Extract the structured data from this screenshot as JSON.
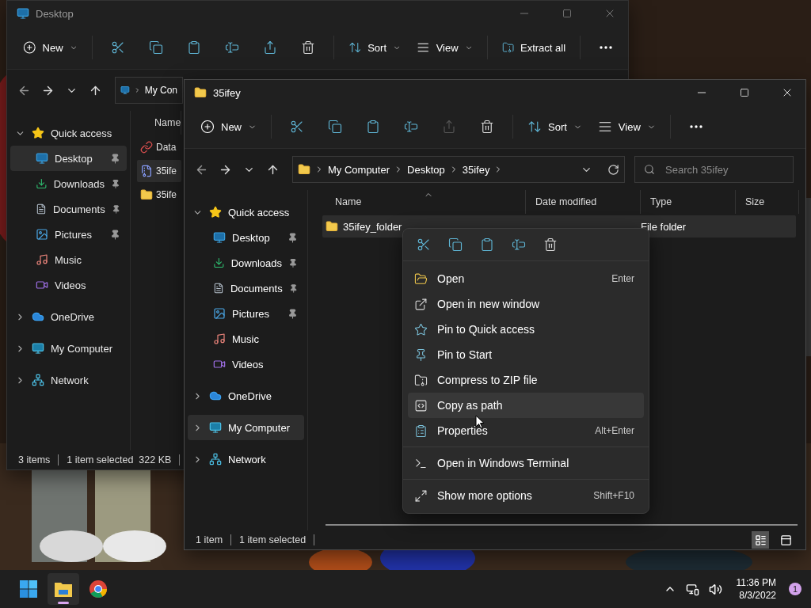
{
  "windows": [
    {
      "title": "Desktop",
      "active": false,
      "toolbar": [
        {
          "kind": "new",
          "label": "New",
          "disabled": false
        },
        {
          "kind": "cut",
          "disabled": false
        },
        {
          "kind": "copy",
          "disabled": false
        },
        {
          "kind": "paste",
          "disabled": false
        },
        {
          "kind": "rename",
          "disabled": false
        },
        {
          "kind": "share",
          "disabled": false
        },
        {
          "kind": "delete",
          "disabled": false
        },
        {
          "kind": "sort",
          "label": "Sort",
          "disabled": false
        },
        {
          "kind": "view",
          "label": "View",
          "disabled": false
        },
        {
          "kind": "extract",
          "label": "Extract all",
          "disabled": false
        },
        {
          "kind": "more",
          "disabled": false
        }
      ],
      "address": {
        "segments": [
          "My Con"
        ]
      },
      "sidebar": [
        {
          "label": "Quick access",
          "kind": "star",
          "expanded": true,
          "selected": false,
          "children": [
            {
              "label": "Desktop",
              "kind": "desktop",
              "pinned": true,
              "selected": true
            },
            {
              "label": "Downloads",
              "kind": "downloads",
              "pinned": true,
              "selected": false
            },
            {
              "label": "Documents",
              "kind": "documents",
              "pinned": true,
              "selected": false
            },
            {
              "label": "Pictures",
              "kind": "pictures",
              "pinned": true,
              "selected": false
            },
            {
              "label": "Music",
              "kind": "music",
              "pinned": false,
              "selected": false
            },
            {
              "label": "Videos",
              "kind": "videos",
              "pinned": false,
              "selected": false
            }
          ]
        },
        {
          "label": "OneDrive",
          "kind": "cloud",
          "expanded": false,
          "selected": false
        },
        {
          "label": "My Computer",
          "kind": "computer",
          "expanded": false,
          "selected": false
        },
        {
          "label": "Network",
          "kind": "network",
          "expanded": false,
          "selected": false
        }
      ],
      "columns": [
        "Name"
      ],
      "rows": [
        {
          "name": "Data",
          "kind": "shortcut",
          "selected": false
        },
        {
          "name": "35ife",
          "kind": "archive",
          "selected": true
        },
        {
          "name": "35ife",
          "kind": "folder",
          "selected": false
        }
      ],
      "status": [
        "3 items",
        "1 item selected  322 KB"
      ]
    },
    {
      "title": "35ifey",
      "active": true,
      "toolbar": [
        {
          "kind": "new",
          "label": "New",
          "disabled": false
        },
        {
          "kind": "cut",
          "disabled": false
        },
        {
          "kind": "copy",
          "disabled": false
        },
        {
          "kind": "paste",
          "disabled": false
        },
        {
          "kind": "rename",
          "disabled": false
        },
        {
          "kind": "share",
          "disabled": true
        },
        {
          "kind": "delete",
          "disabled": false
        },
        {
          "kind": "sort",
          "label": "Sort",
          "disabled": false
        },
        {
          "kind": "view",
          "label": "View",
          "disabled": false
        },
        {
          "kind": "more",
          "disabled": false
        }
      ],
      "address": {
        "segments": [
          "My Computer",
          "Desktop",
          "35ifey"
        ]
      },
      "search": {
        "placeholder": "Search 35ifey"
      },
      "sidebar": [
        {
          "label": "Quick access",
          "kind": "star",
          "expanded": true,
          "selected": false,
          "children": [
            {
              "label": "Desktop",
              "kind": "desktop",
              "pinned": true,
              "selected": false
            },
            {
              "label": "Downloads",
              "kind": "downloads",
              "pinned": true,
              "selected": false
            },
            {
              "label": "Documents",
              "kind": "documents",
              "pinned": true,
              "selected": false
            },
            {
              "label": "Pictures",
              "kind": "pictures",
              "pinned": true,
              "selected": false
            },
            {
              "label": "Music",
              "kind": "music",
              "pinned": false,
              "selected": false
            },
            {
              "label": "Videos",
              "kind": "videos",
              "pinned": false,
              "selected": false
            }
          ]
        },
        {
          "label": "OneDrive",
          "kind": "cloud",
          "expanded": false,
          "selected": false
        },
        {
          "label": "My Computer",
          "kind": "computer",
          "expanded": false,
          "selected": true
        },
        {
          "label": "Network",
          "kind": "network",
          "expanded": false,
          "selected": false
        }
      ],
      "columns": [
        "Name",
        "Date modified",
        "Type",
        "Size"
      ],
      "rows": [
        {
          "name": "35ifey_folder",
          "kind": "folder",
          "type": "File folder",
          "selected": true
        }
      ],
      "status": [
        "1 item",
        "1 item selected"
      ],
      "views": [
        {
          "kind": "details",
          "selected": true
        },
        {
          "kind": "tiles",
          "selected": false
        }
      ]
    }
  ],
  "context_menu": {
    "quick_actions": [
      {
        "kind": "cut"
      },
      {
        "kind": "copy"
      },
      {
        "kind": "paste"
      },
      {
        "kind": "rename"
      },
      {
        "kind": "delete"
      }
    ],
    "sections": [
      [
        {
          "kind": "open",
          "label": "Open",
          "shortcut": "Enter",
          "hovered": false
        },
        {
          "kind": "new-window",
          "label": "Open in new window",
          "hovered": false
        },
        {
          "kind": "pin-quick",
          "label": "Pin to Quick access",
          "hovered": false
        },
        {
          "kind": "pin-start",
          "label": "Pin to Start",
          "hovered": false
        },
        {
          "kind": "zip",
          "label": "Compress to ZIP file",
          "hovered": false
        },
        {
          "kind": "path",
          "label": "Copy as path",
          "hovered": true
        },
        {
          "kind": "properties",
          "label": "Properties",
          "shortcut": "Alt+Enter",
          "hovered": false
        }
      ],
      [
        {
          "kind": "terminal",
          "label": "Open in Windows Terminal",
          "hovered": false
        }
      ],
      [
        {
          "kind": "more",
          "label": "Show more options",
          "shortcut": "Shift+F10",
          "hovered": false
        }
      ]
    ]
  },
  "taskbar": {
    "apps": [
      {
        "kind": "start",
        "active": false
      },
      {
        "kind": "explorer",
        "active": true
      },
      {
        "kind": "chrome",
        "active": false
      }
    ],
    "time": "11:36 PM",
    "date": "8/3/2022",
    "notifications": "1"
  }
}
